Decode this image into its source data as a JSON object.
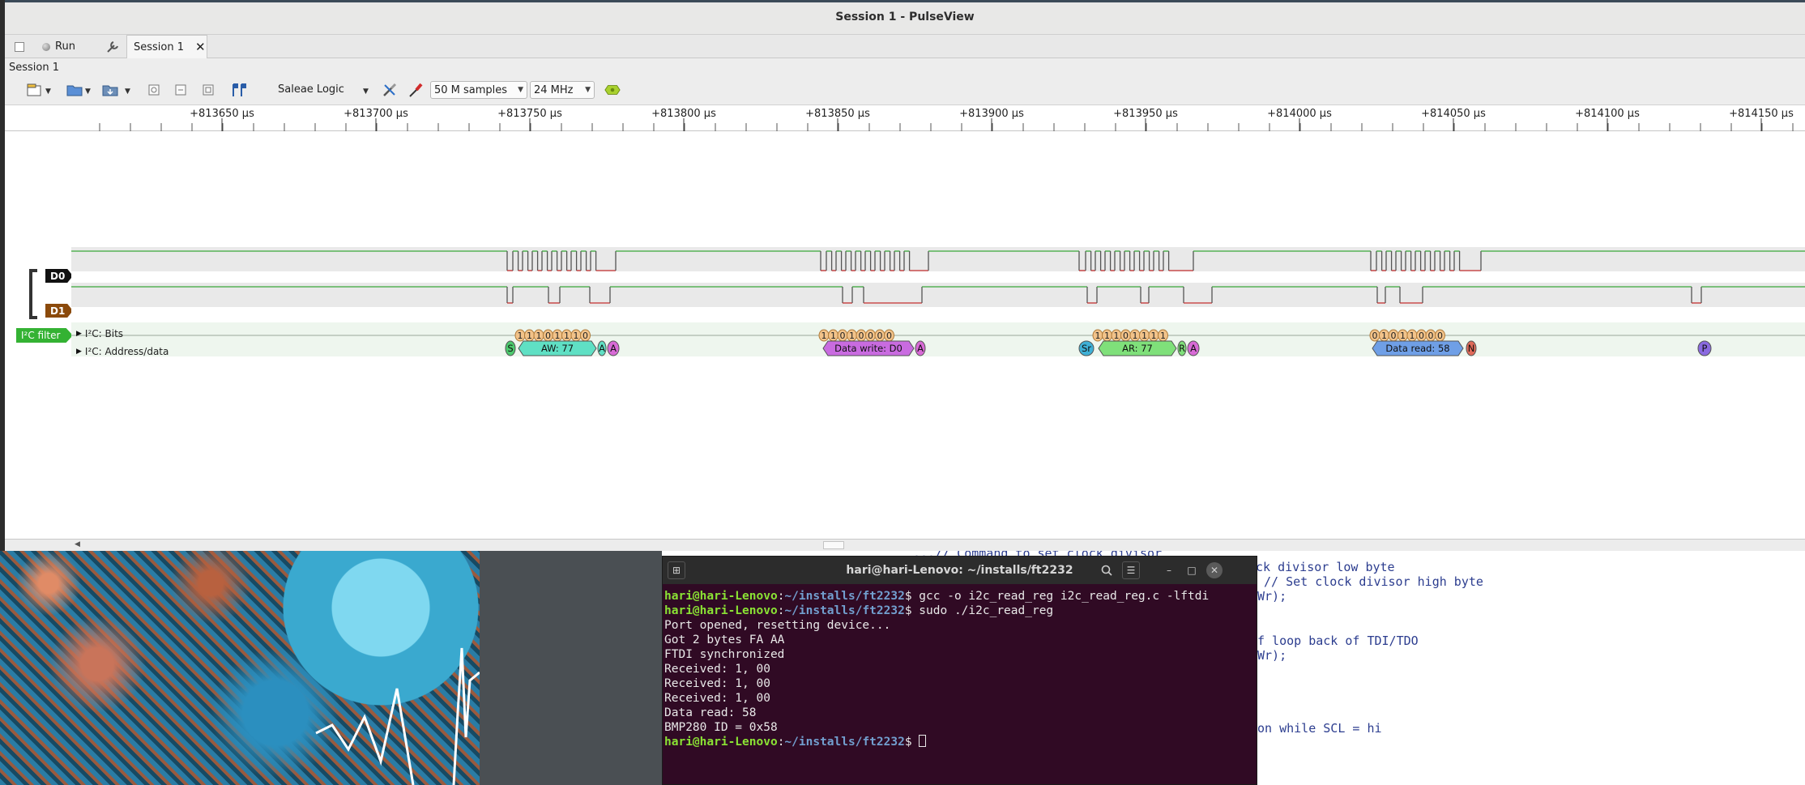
{
  "window": {
    "title": "Session 1 - PulseView"
  },
  "tabs": {
    "run_label": "Run",
    "session_tab_label": "Session 1"
  },
  "session_label": "Session 1",
  "toolbar": {
    "device": "Saleae Logic",
    "samples": "50 M samples",
    "samplerate": "24 MHz"
  },
  "ruler": {
    "ticks": [
      "+813650 µs",
      "+813700 µs",
      "+813750 µs",
      "+813800 µs",
      "+813850 µs",
      "+813900 µs",
      "+813950 µs",
      "+814000 µs",
      "+814050 µs",
      "+814100 µs",
      "+814150 µs"
    ]
  },
  "channels": {
    "d0": "D0",
    "d1": "D1",
    "filter": "I²C filter",
    "bits_row": "I²C: Bits",
    "addr_row": "I²C: Address/data"
  },
  "decode": {
    "bit_groups": [
      {
        "bits": [
          "1",
          "1",
          "1",
          "0",
          "1",
          "1",
          "1",
          "0"
        ]
      },
      {
        "bits": [
          "1",
          "1",
          "0",
          "1",
          "0",
          "0",
          "0",
          "0"
        ]
      },
      {
        "bits": [
          "1",
          "1",
          "1",
          "0",
          "1",
          "1",
          "1",
          "1"
        ]
      },
      {
        "bits": [
          "0",
          "1",
          "0",
          "1",
          "1",
          "0",
          "0",
          "0"
        ]
      }
    ],
    "annotations": [
      {
        "text": "S",
        "color": "#4cc96d"
      },
      {
        "text": "AW: 77",
        "color": "#5fe0c4"
      },
      {
        "text": "A",
        "color": "#5fe0c4"
      },
      {
        "text": "A",
        "color": "#d86ad6"
      },
      {
        "text": "Data write: D0",
        "color": "#c96be0"
      },
      {
        "text": "A",
        "color": "#d86ad6"
      },
      {
        "text": "Sr",
        "color": "#3fb0d6"
      },
      {
        "text": "AR: 77",
        "color": "#7fe07a"
      },
      {
        "text": "R",
        "color": "#7fe07a"
      },
      {
        "text": "A",
        "color": "#d86ad6"
      },
      {
        "text": "Data read: 58",
        "color": "#6f9fe6"
      },
      {
        "text": "N",
        "color": "#e06a5a"
      },
      {
        "text": "P",
        "color": "#8a6ae0"
      }
    ]
  },
  "terminal": {
    "title": "hari@hari-Lenovo: ~/installs/ft2232",
    "prompt_user": "hari@hari-Lenovo",
    "prompt_path": "~/installs/ft2232",
    "cmd1": "gcc -o i2c_read_reg i2c_read_reg.c -lftdi",
    "cmd2": "sudo ./i2c_read_reg",
    "output": [
      "Port opened, resetting device...",
      "Got 2 bytes FA AA",
      "FTDI synchronized",
      "Received: 1, 00",
      "Received: 1, 00",
      "Received: 1, 00",
      "Data read: 58",
      "BMP280 ID = 0x58"
    ]
  },
  "editor_fragments": [
    "...// Command to set clock divisor",
    "ck divisor low byte",
    "// Set clock divisor high byte",
    "Wr);",
    "f loop back of TDI/TDO",
    "Wr);",
    "on while SCL = hi"
  ]
}
